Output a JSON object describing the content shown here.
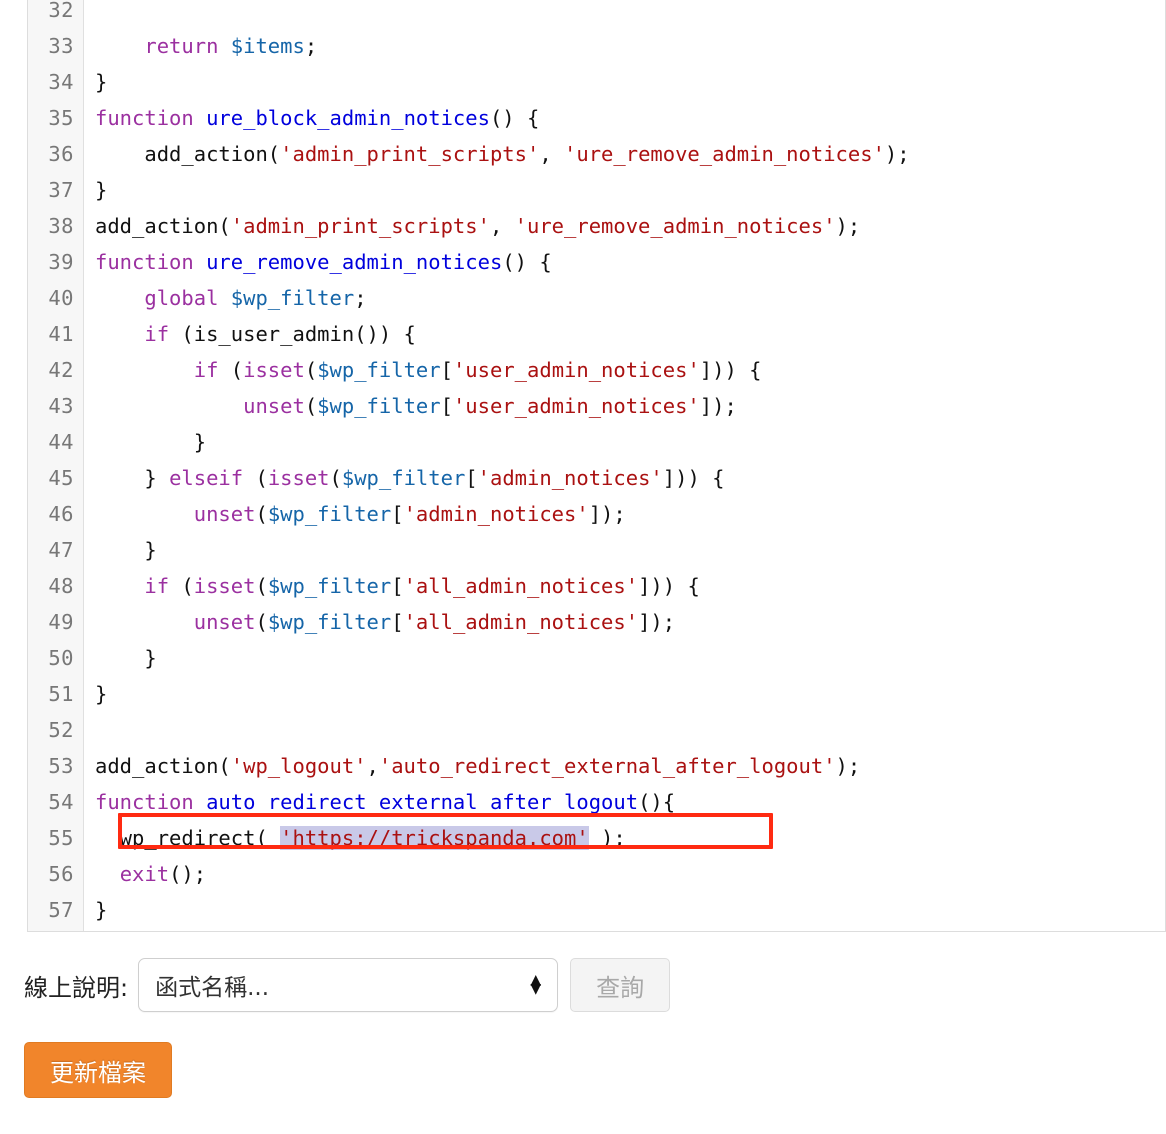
{
  "editor": {
    "name": "file-editor",
    "first_visible_line": 32,
    "lines": [
      {
        "n": "32",
        "tokens": []
      },
      {
        "n": "33",
        "tokens": [
          {
            "t": "    ",
            "c": "pl"
          },
          {
            "t": "return",
            "c": "kw"
          },
          {
            "t": " ",
            "c": "pl"
          },
          {
            "t": "$items",
            "c": "var"
          },
          {
            "t": ";",
            "c": "pl"
          }
        ]
      },
      {
        "n": "34",
        "tokens": [
          {
            "t": "}",
            "c": "pl"
          }
        ]
      },
      {
        "n": "35",
        "tokens": [
          {
            "t": "function",
            "c": "kw"
          },
          {
            "t": " ",
            "c": "pl"
          },
          {
            "t": "ure_block_admin_notices",
            "c": "fn"
          },
          {
            "t": "() {",
            "c": "pl"
          }
        ]
      },
      {
        "n": "36",
        "tokens": [
          {
            "t": "    add_action(",
            "c": "pl"
          },
          {
            "t": "'admin_print_scripts'",
            "c": "str"
          },
          {
            "t": ", ",
            "c": "pl"
          },
          {
            "t": "'ure_remove_admin_notices'",
            "c": "str"
          },
          {
            "t": ");",
            "c": "pl"
          }
        ]
      },
      {
        "n": "37",
        "tokens": [
          {
            "t": "}",
            "c": "pl"
          }
        ]
      },
      {
        "n": "38",
        "tokens": [
          {
            "t": "add_action(",
            "c": "pl"
          },
          {
            "t": "'admin_print_scripts'",
            "c": "str"
          },
          {
            "t": ", ",
            "c": "pl"
          },
          {
            "t": "'ure_remove_admin_notices'",
            "c": "str"
          },
          {
            "t": ");",
            "c": "pl"
          }
        ]
      },
      {
        "n": "39",
        "tokens": [
          {
            "t": "function",
            "c": "kw"
          },
          {
            "t": " ",
            "c": "pl"
          },
          {
            "t": "ure_remove_admin_notices",
            "c": "fn"
          },
          {
            "t": "() {",
            "c": "pl"
          }
        ]
      },
      {
        "n": "40",
        "tokens": [
          {
            "t": "    ",
            "c": "pl"
          },
          {
            "t": "global",
            "c": "kw"
          },
          {
            "t": " ",
            "c": "pl"
          },
          {
            "t": "$wp_filter",
            "c": "var"
          },
          {
            "t": ";",
            "c": "pl"
          }
        ]
      },
      {
        "n": "41",
        "tokens": [
          {
            "t": "    ",
            "c": "pl"
          },
          {
            "t": "if",
            "c": "kw"
          },
          {
            "t": " (is_user_admin()) {",
            "c": "pl"
          }
        ]
      },
      {
        "n": "42",
        "tokens": [
          {
            "t": "        ",
            "c": "pl"
          },
          {
            "t": "if",
            "c": "kw"
          },
          {
            "t": " (",
            "c": "pl"
          },
          {
            "t": "isset",
            "c": "kw"
          },
          {
            "t": "(",
            "c": "pl"
          },
          {
            "t": "$wp_filter",
            "c": "var"
          },
          {
            "t": "[",
            "c": "pl"
          },
          {
            "t": "'user_admin_notices'",
            "c": "str"
          },
          {
            "t": "])) {",
            "c": "pl"
          }
        ]
      },
      {
        "n": "43",
        "tokens": [
          {
            "t": "            ",
            "c": "pl"
          },
          {
            "t": "unset",
            "c": "kw"
          },
          {
            "t": "(",
            "c": "pl"
          },
          {
            "t": "$wp_filter",
            "c": "var"
          },
          {
            "t": "[",
            "c": "pl"
          },
          {
            "t": "'user_admin_notices'",
            "c": "str"
          },
          {
            "t": "]);",
            "c": "pl"
          }
        ]
      },
      {
        "n": "44",
        "tokens": [
          {
            "t": "        }",
            "c": "pl"
          }
        ]
      },
      {
        "n": "45",
        "tokens": [
          {
            "t": "    } ",
            "c": "pl"
          },
          {
            "t": "elseif",
            "c": "kw"
          },
          {
            "t": " (",
            "c": "pl"
          },
          {
            "t": "isset",
            "c": "kw"
          },
          {
            "t": "(",
            "c": "pl"
          },
          {
            "t": "$wp_filter",
            "c": "var"
          },
          {
            "t": "[",
            "c": "pl"
          },
          {
            "t": "'admin_notices'",
            "c": "str"
          },
          {
            "t": "])) {",
            "c": "pl"
          }
        ]
      },
      {
        "n": "46",
        "tokens": [
          {
            "t": "        ",
            "c": "pl"
          },
          {
            "t": "unset",
            "c": "kw"
          },
          {
            "t": "(",
            "c": "pl"
          },
          {
            "t": "$wp_filter",
            "c": "var"
          },
          {
            "t": "[",
            "c": "pl"
          },
          {
            "t": "'admin_notices'",
            "c": "str"
          },
          {
            "t": "]);",
            "c": "pl"
          }
        ]
      },
      {
        "n": "47",
        "tokens": [
          {
            "t": "    }",
            "c": "pl"
          }
        ]
      },
      {
        "n": "48",
        "tokens": [
          {
            "t": "    ",
            "c": "pl"
          },
          {
            "t": "if",
            "c": "kw"
          },
          {
            "t": " (",
            "c": "pl"
          },
          {
            "t": "isset",
            "c": "kw"
          },
          {
            "t": "(",
            "c": "pl"
          },
          {
            "t": "$wp_filter",
            "c": "var"
          },
          {
            "t": "[",
            "c": "pl"
          },
          {
            "t": "'all_admin_notices'",
            "c": "str"
          },
          {
            "t": "])) {",
            "c": "pl"
          }
        ]
      },
      {
        "n": "49",
        "tokens": [
          {
            "t": "        ",
            "c": "pl"
          },
          {
            "t": "unset",
            "c": "kw"
          },
          {
            "t": "(",
            "c": "pl"
          },
          {
            "t": "$wp_filter",
            "c": "var"
          },
          {
            "t": "[",
            "c": "pl"
          },
          {
            "t": "'all_admin_notices'",
            "c": "str"
          },
          {
            "t": "]);",
            "c": "pl"
          }
        ]
      },
      {
        "n": "50",
        "tokens": [
          {
            "t": "    }",
            "c": "pl"
          }
        ]
      },
      {
        "n": "51",
        "tokens": [
          {
            "t": "}",
            "c": "pl"
          }
        ]
      },
      {
        "n": "52",
        "tokens": []
      },
      {
        "n": "53",
        "tokens": [
          {
            "t": "add_action(",
            "c": "pl"
          },
          {
            "t": "'wp_logout'",
            "c": "str"
          },
          {
            "t": ",",
            "c": "pl"
          },
          {
            "t": "'auto_redirect_external_after_logout'",
            "c": "str"
          },
          {
            "t": ");",
            "c": "pl"
          }
        ]
      },
      {
        "n": "54",
        "tokens": [
          {
            "t": "function",
            "c": "kw"
          },
          {
            "t": " ",
            "c": "pl"
          },
          {
            "t": "auto_redirect_external_after_logout",
            "c": "fn"
          },
          {
            "t": "(){",
            "c": "pl"
          }
        ]
      },
      {
        "n": "55",
        "tokens": [
          {
            "t": "  wp_redirect( ",
            "c": "pl"
          },
          {
            "t": "'https://trickspanda.com'",
            "c": "str sel"
          },
          {
            "t": " );",
            "c": "pl"
          }
        ]
      },
      {
        "n": "56",
        "tokens": [
          {
            "t": "  ",
            "c": "pl"
          },
          {
            "t": "exit",
            "c": "kw"
          },
          {
            "t": "();",
            "c": "pl"
          }
        ]
      },
      {
        "n": "57",
        "tokens": [
          {
            "t": "}",
            "c": "pl"
          }
        ]
      }
    ]
  },
  "annotation": {
    "name": "red-highlight-box",
    "target_line": "55",
    "color": "#FF2A11"
  },
  "docs": {
    "label": "線上說明:",
    "select_value": "函式名稱...",
    "lookup_label": "查詢",
    "lookup_disabled": true
  },
  "actions": {
    "update_label": "更新檔案",
    "update_color": "#F1852B"
  }
}
